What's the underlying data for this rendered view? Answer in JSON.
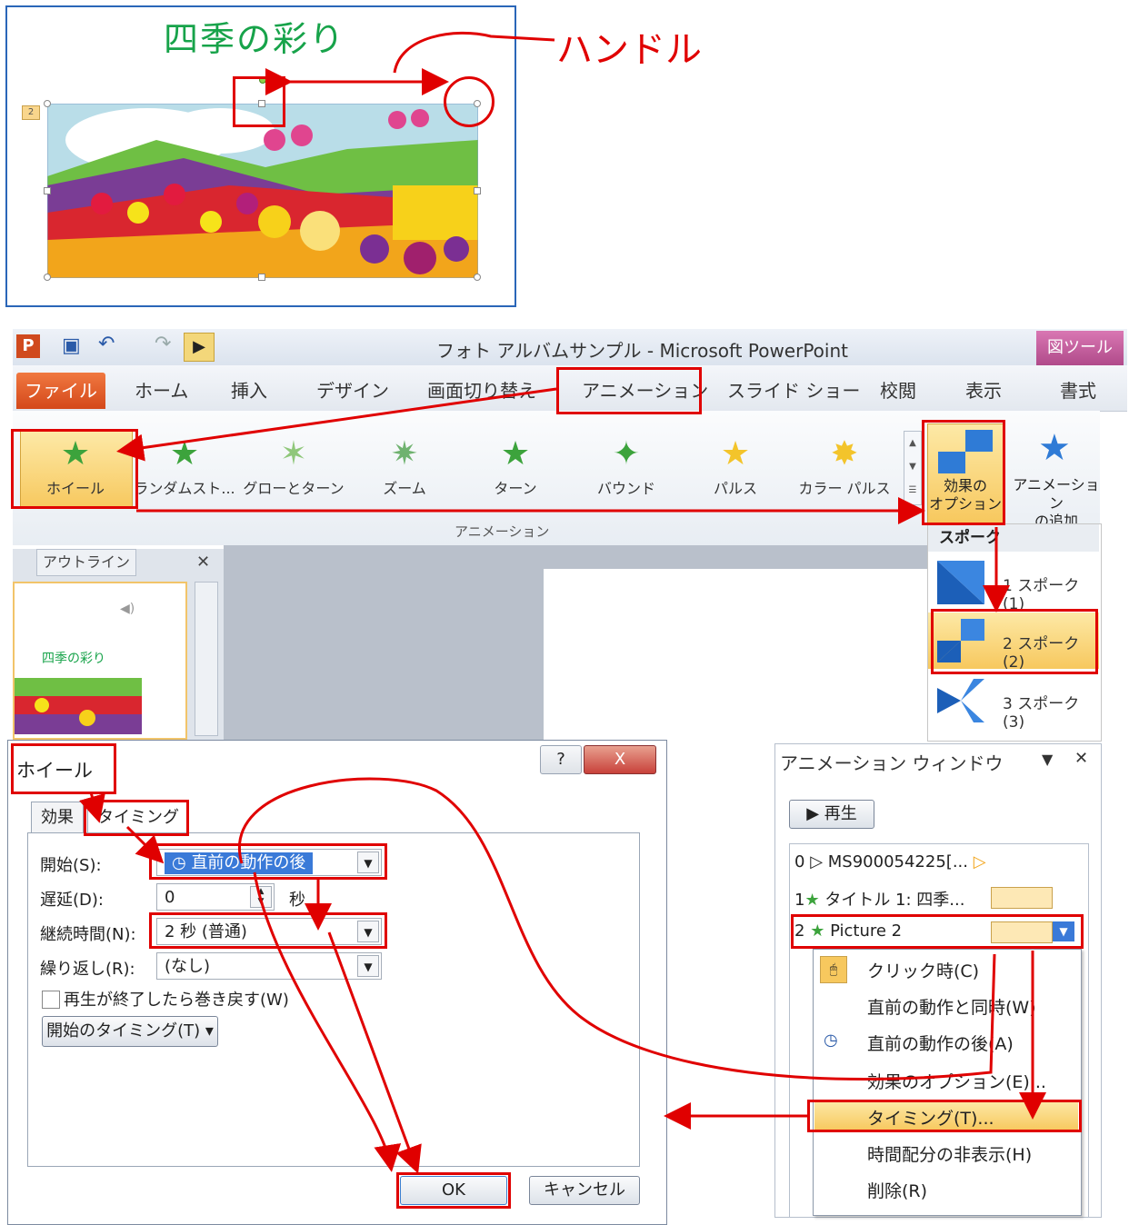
{
  "slide": {
    "title": "四季の彩り",
    "anim_tag": "2"
  },
  "annotation": {
    "handle_label": "ハンドル"
  },
  "window": {
    "title": "フォト アルバムサンプル - Microsoft PowerPoint",
    "tool_context": "図ツール"
  },
  "tabs": {
    "file": "ファイル",
    "home": "ホーム",
    "insert": "挿入",
    "design": "デザイン",
    "transitions": "画面切り替え",
    "animations": "アニメーション",
    "slideshow": "スライド ショー",
    "review": "校閲",
    "view": "表示",
    "format": "書式"
  },
  "gallery": [
    "ホイール",
    "ランダムスト...",
    "グローとターン",
    "ズーム",
    "ターン",
    "バウンド",
    "パルス",
    "カラー パルス"
  ],
  "ribbon": {
    "effect_options": "効果の\nオプション",
    "add_animation": "アニメーション\nの追加",
    "group_label": "アニメーション"
  },
  "outline": {
    "tab_label": "アウトライン",
    "thumb_title": "四季の彩り"
  },
  "spoke_menu": {
    "header": "スポーク",
    "items": [
      "1 スポーク(1)",
      "2 スポーク(2)",
      "3 スポーク(3)"
    ]
  },
  "dialog": {
    "title": "ホイール",
    "help": "?",
    "close": "X",
    "tabs": [
      "効果",
      "タイミング"
    ],
    "start_label": "開始(S):",
    "start_value": "直前の動作の後",
    "delay_label": "遅延(D):",
    "delay_value": "0",
    "delay_unit": "秒",
    "duration_label": "継続時間(N):",
    "duration_value": "2 秒 (普通)",
    "repeat_label": "繰り返し(R):",
    "repeat_value": "(なし)",
    "rewind_label": "再生が終了したら巻き戻す(W)",
    "triggers_label": "開始のタイミング(T)",
    "ok": "OK",
    "cancel": "キャンセル"
  },
  "anim_pane": {
    "title": "アニメーション ウィンドウ",
    "play": "再生",
    "rows": [
      {
        "num": "0",
        "name": "MS900054225[..."
      },
      {
        "num": "1",
        "name": "タイトル 1: 四季..."
      },
      {
        "num": "2",
        "name": "Picture 2"
      }
    ]
  },
  "context_menu": [
    "クリック時(C)",
    "直前の動作と同時(W)",
    "直前の動作の後(A)",
    "効果のオプション(E)...",
    "タイミング(T)...",
    "時間配分の非表示(H)",
    "削除(R)"
  ],
  "colors": {
    "annotation_red": "#e00000",
    "accent_green": "#17a34a",
    "file_tab": "#d4481a",
    "context_tab": "#b04a8a"
  }
}
